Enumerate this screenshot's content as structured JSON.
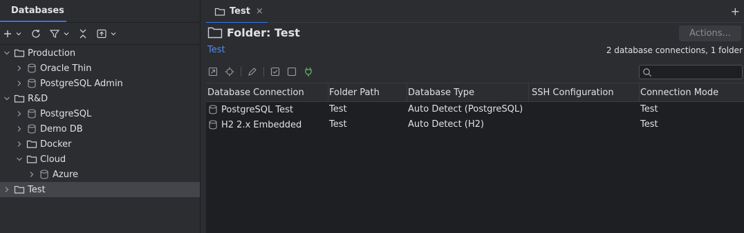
{
  "left_panel": {
    "title": "Databases",
    "toolbar": {
      "add": "plus-icon",
      "refresh": "refresh-icon",
      "filter": "filter-icon",
      "collapse": "collapse-all-icon",
      "link": "link-with-editor-icon"
    },
    "tree": [
      {
        "label": "Production",
        "type": "folder",
        "expanded": true,
        "level": 0
      },
      {
        "label": "Oracle Thin",
        "type": "database",
        "expanded": false,
        "level": 1
      },
      {
        "label": "PostgreSQL Admin",
        "type": "database",
        "expanded": false,
        "level": 1
      },
      {
        "label": "R&D",
        "type": "folder",
        "expanded": true,
        "level": 0
      },
      {
        "label": "PostgreSQL",
        "type": "database",
        "expanded": false,
        "level": 1
      },
      {
        "label": "Demo DB",
        "type": "database",
        "expanded": false,
        "level": 1
      },
      {
        "label": "Docker",
        "type": "folder",
        "expanded": false,
        "level": 1
      },
      {
        "label": "Cloud",
        "type": "folder",
        "expanded": true,
        "level": 1
      },
      {
        "label": "Azure",
        "type": "database",
        "expanded": false,
        "level": 2
      },
      {
        "label": "Test",
        "type": "folder",
        "expanded": false,
        "level": 0,
        "selected": true
      }
    ]
  },
  "editor": {
    "tab": {
      "label": "Test",
      "close": "×"
    },
    "add_tab": "+",
    "header": {
      "title": "Folder: Test",
      "actions_label": "Actions...",
      "breadcrumb_link": "Test",
      "summary": "2 database connections, 1 folder"
    },
    "table": {
      "columns": [
        "Database Connection",
        "Folder Path",
        "Database Type",
        "SSH Configuration",
        "Connection Mode"
      ],
      "rows": [
        [
          "PostgreSQL Test",
          "Test",
          "Auto Detect (PostgreSQL)",
          "",
          "Test"
        ],
        [
          "H2 2.x Embedded",
          "Test",
          "Auto Detect (H2)",
          "",
          "Test"
        ]
      ]
    }
  },
  "colors": {
    "accent": "#3574f0",
    "link": "#548af7",
    "plug": "#5fb865"
  }
}
